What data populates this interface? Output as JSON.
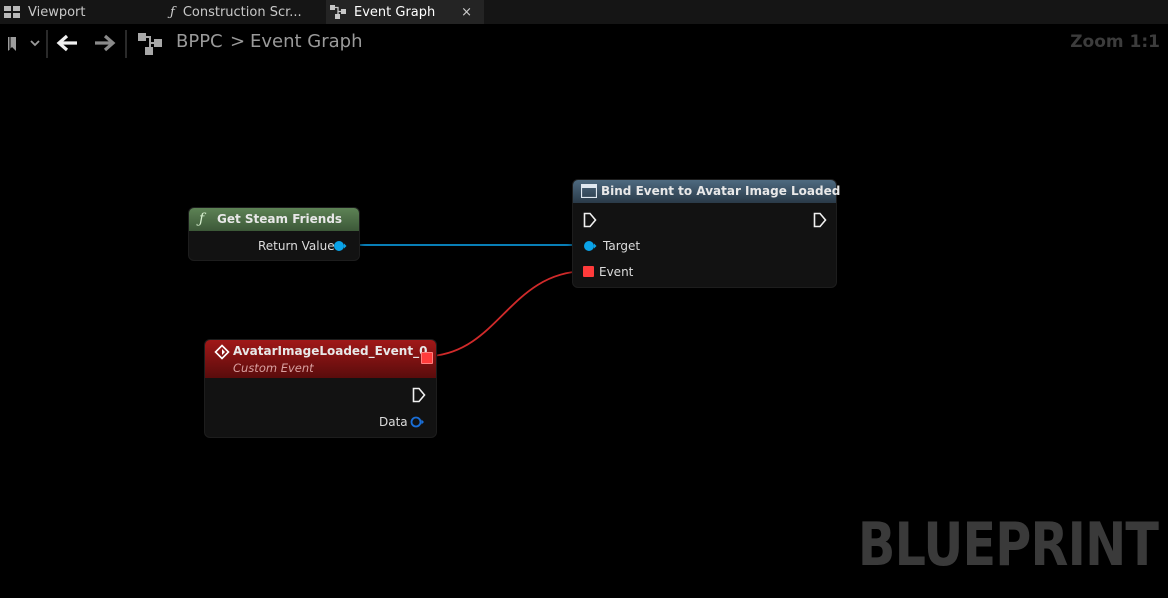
{
  "tabs": [
    {
      "label": "Viewport",
      "icon": "viewport-icon"
    },
    {
      "label": "Construction Scr...",
      "icon": "function-icon"
    },
    {
      "label": "Event Graph",
      "icon": "graph-icon",
      "active": true
    }
  ],
  "tab_close": "×",
  "breadcrumb": {
    "root": "BPPC",
    "separator": ">",
    "current": "Event Graph"
  },
  "zoom_label": "Zoom 1:1",
  "watermark": "BLUEPRINT",
  "nodes": {
    "get_steam_friends": {
      "title": "Get Steam Friends",
      "output_pin": "Return Value"
    },
    "bind_event": {
      "title": "Bind Event to Avatar Image Loaded",
      "pins": [
        "Target",
        "Event"
      ]
    },
    "custom_event": {
      "title": "AvatarImageLoaded_Event_0",
      "subtitle": "Custom Event",
      "output_pin": "Data"
    }
  },
  "colors": {
    "object_pin": "#0aa3e8",
    "delegate_pin": "#ff3b3b",
    "pure_function_header": "#4b6e46",
    "function_header": "#3d5366",
    "event_header": "#8d1010"
  }
}
